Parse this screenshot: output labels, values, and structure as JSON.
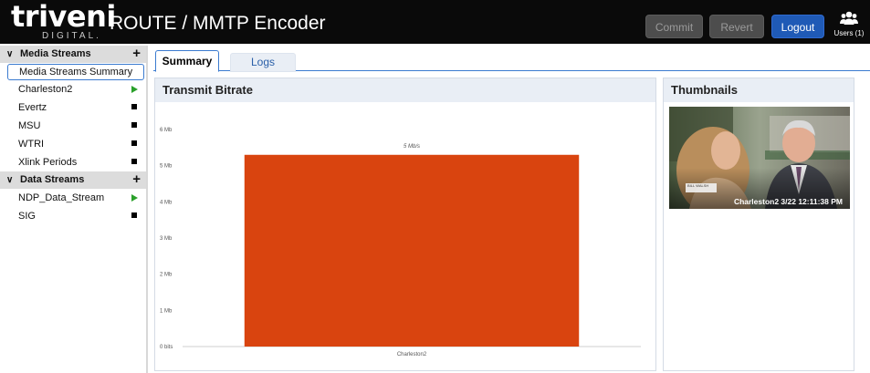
{
  "header": {
    "logo_main": "triveni",
    "logo_sub": "DIGITAL.",
    "title": "ROUTE / MMTP Encoder",
    "commit_label": "Commit",
    "revert_label": "Revert",
    "logout_label": "Logout",
    "users_label": "Users (1)",
    "users_icon": "users-icon"
  },
  "sidebar": {
    "media_group": {
      "label": "Media Streams",
      "add_symbol": "+",
      "items": [
        {
          "label": "Media Streams Summary",
          "selected": true
        },
        {
          "label": "Charleston2",
          "status": "playing"
        },
        {
          "label": "Evertz",
          "status": "stopped"
        },
        {
          "label": "MSU",
          "status": "stopped"
        },
        {
          "label": "WTRI",
          "status": "stopped"
        },
        {
          "label": "Xlink Periods",
          "status": "stopped"
        }
      ]
    },
    "data_group": {
      "label": "Data Streams",
      "add_symbol": "+",
      "items": [
        {
          "label": "NDP_Data_Stream",
          "status": "playing"
        },
        {
          "label": "SIG",
          "status": "stopped"
        }
      ]
    }
  },
  "tabs": [
    {
      "label": "Summary",
      "active": true
    },
    {
      "label": "Logs",
      "active": false
    }
  ],
  "bitrate_panel": {
    "title": "Transmit Bitrate"
  },
  "thumbnails_panel": {
    "title": "Thumbnails",
    "caption": "Charleston2 3/22 12:11:38 PM",
    "lower_third_name": "BILL WALSH"
  },
  "chart_data": {
    "type": "bar",
    "categories": [
      "Charleston2"
    ],
    "values": [
      5.3
    ],
    "data_labels": [
      "5 Mb/s"
    ],
    "y_ticks": [
      {
        "value": 0,
        "label": "0 bits"
      },
      {
        "value": 1,
        "label": "1 Mb"
      },
      {
        "value": 2,
        "label": "2 Mb"
      },
      {
        "value": 3,
        "label": "3 Mb"
      },
      {
        "value": 4,
        "label": "4 Mb"
      },
      {
        "value": 5,
        "label": "5 Mb"
      },
      {
        "value": 6,
        "label": "6 Mb"
      }
    ],
    "ylim": [
      0,
      6
    ],
    "bar_color": "#d9440f",
    "grid": false
  },
  "colors": {
    "accent": "#1f5ab6",
    "play": "#2aa02a",
    "header_bg": "#0a0a0a"
  }
}
